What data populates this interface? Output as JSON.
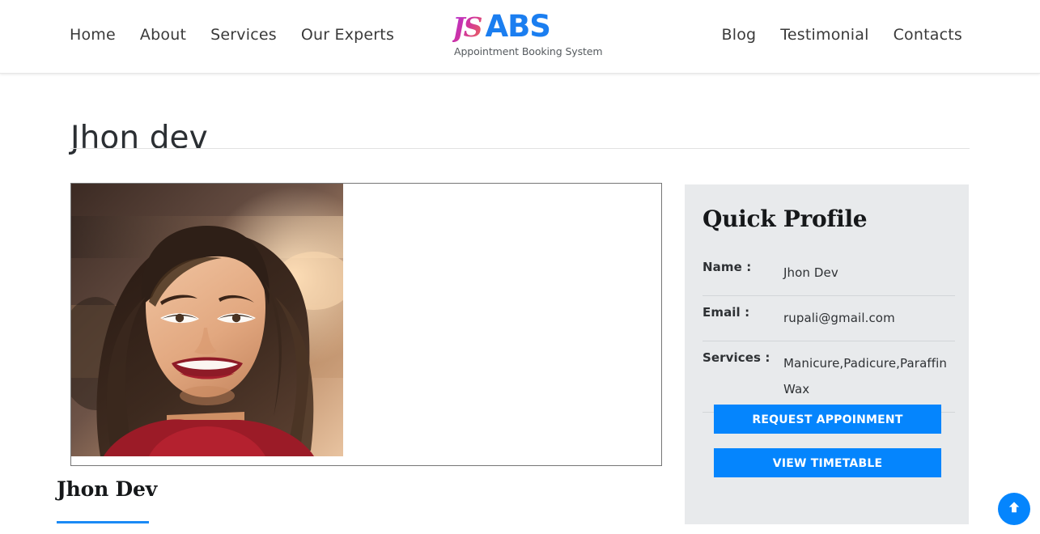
{
  "header": {
    "nav_left": [
      {
        "label": "Home",
        "name": "nav-home"
      },
      {
        "label": "About",
        "name": "nav-about"
      },
      {
        "label": "Services",
        "name": "nav-services"
      },
      {
        "label": "Our Experts",
        "name": "nav-our-experts"
      }
    ],
    "nav_right": [
      {
        "label": "Blog",
        "name": "nav-blog"
      },
      {
        "label": "Testimonial",
        "name": "nav-testimonial"
      },
      {
        "label": "Contacts",
        "name": "nav-contacts"
      }
    ],
    "logo": {
      "monogram": "JS",
      "mark": "ABS",
      "tagline": "Appointment Booking System",
      "mark_color": "#1b7ef0",
      "monogram_color": "#b12fd6"
    }
  },
  "page": {
    "title": "Jhon dev"
  },
  "expert": {
    "name": "Jhon Dev",
    "photo_alt": "smiling woman portrait",
    "accent_color": "#1b8af5"
  },
  "sidebar": {
    "title": "Quick Profile",
    "rows": [
      {
        "label": "Name :",
        "value": "Jhon Dev"
      },
      {
        "label": "Email :",
        "value": "rupali@gmail.com"
      },
      {
        "label": "Services :",
        "value": "Manicure,Padicure,Paraffin Wax"
      }
    ],
    "buttons": [
      {
        "label": "REQUEST APPOINMENT",
        "name": "request-appointment-button"
      },
      {
        "label": "VIEW TIMETABLE",
        "name": "view-timetable-button"
      }
    ],
    "background_color": "#e8eaec",
    "button_color": "#0585fd"
  },
  "scroll_top": {
    "icon": "arrow-up-icon",
    "color": "#0585fd"
  }
}
